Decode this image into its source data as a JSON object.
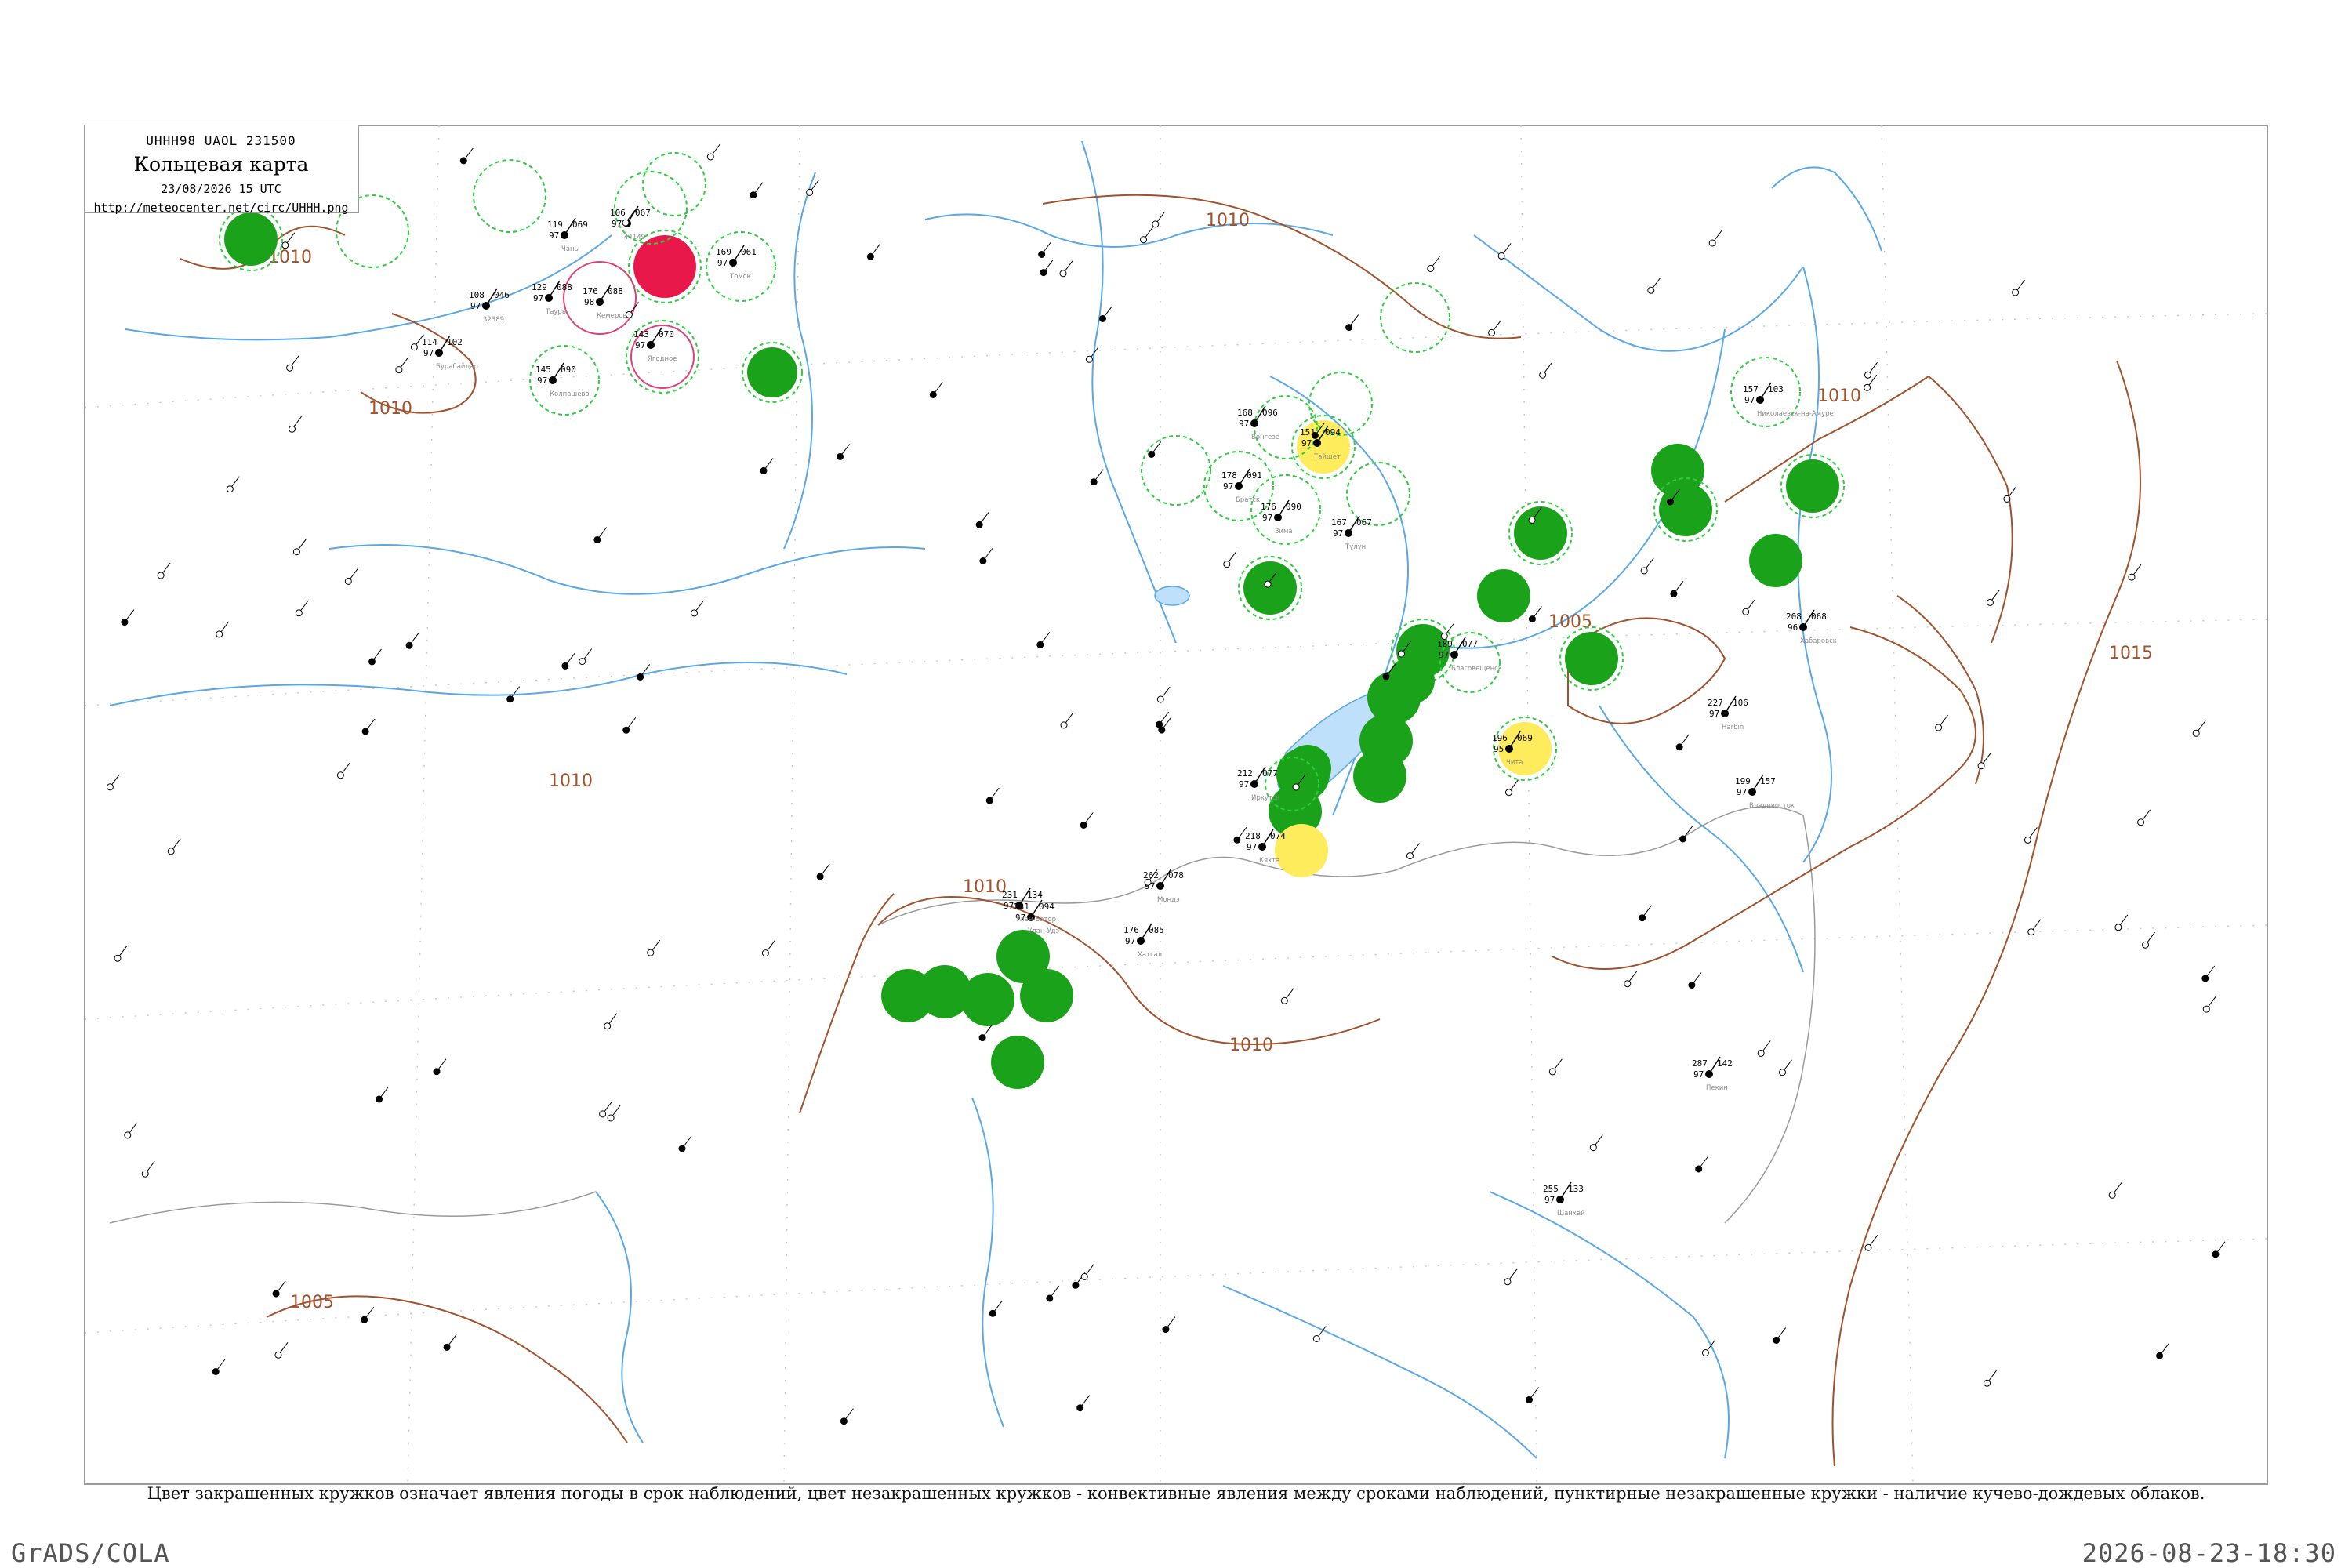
{
  "header": {
    "code": "UHHH98  UAOL  231500",
    "title": "Кольцевая карта",
    "date": "23/08/2026 15 UTC",
    "url": "http://meteocenter.net/circ/UHHH.png"
  },
  "caption": "Цвет закрашенных кружков означает явления погоды в срок наблюдений, цвет незакрашенных кружков - конвективные явления между сроками наблюдений, пунктирные незакрашенные кружки - наличие кучево-дождевых облаков.",
  "footer": {
    "left": "GrADS/COLA",
    "right": "2026-08-23-18:30"
  },
  "isobar_labels": [
    {
      "text": "1010"
    },
    {
      "text": "1010"
    },
    {
      "text": "1010"
    },
    {
      "text": "1010"
    },
    {
      "text": "1010"
    },
    {
      "text": "1010"
    },
    {
      "text": "1010"
    },
    {
      "text": "1005"
    },
    {
      "text": "1005"
    },
    {
      "text": "1015"
    }
  ],
  "colors": {
    "heavy_rain": "#1aa31a",
    "rain_ring": "#2ecc40",
    "fog_yellow": "#ffec5c",
    "thunder_red": "#e8184a",
    "thunder_ring": "#e0407a",
    "isobar": "#a0522d",
    "river": "#5aa7e6",
    "border": "#8a8a8a"
  },
  "stations": [
    {
      "name": "32389",
      "t": "108",
      "tw": "97",
      "p": "046"
    },
    {
      "name": "Бурабайдар",
      "t": "114",
      "tw": "97",
      "p": "102"
    },
    {
      "name": "Тауры",
      "t": "129",
      "tw": "97",
      "p": "088"
    },
    {
      "name": "Чаны",
      "t": "119",
      "tw": "97",
      "p": "069"
    },
    {
      "name": "44149",
      "t": "106",
      "tw": "97",
      "p": "067"
    },
    {
      "name": "Томск",
      "t": "169",
      "tw": "97",
      "p": "061"
    },
    {
      "name": "Колпашево",
      "t": "145",
      "tw": "97",
      "p": "090"
    },
    {
      "name": "Ягодное",
      "t": "143",
      "tw": "97",
      "p": "070"
    },
    {
      "name": "Кемерово",
      "t": "176",
      "tw": "98",
      "p": "088"
    },
    {
      "name": "Вонгезе",
      "t": "168",
      "tw": "97",
      "p": "096"
    },
    {
      "name": "Тайшет",
      "t": "151",
      "tw": "97",
      "p": "094"
    },
    {
      "name": "Братск",
      "t": "178",
      "tw": "97",
      "p": "091"
    },
    {
      "name": "Зима",
      "t": "176",
      "tw": "97",
      "p": "090"
    },
    {
      "name": "Тулун",
      "t": "167",
      "tw": "97",
      "p": "067"
    },
    {
      "name": "Иркутск",
      "t": "212",
      "tw": "97",
      "p": "077"
    },
    {
      "name": "Улан-Удэ",
      "t": "231",
      "tw": "97",
      "p": "094"
    },
    {
      "name": "Кяхта",
      "t": "218",
      "tw": "97",
      "p": "074"
    },
    {
      "name": "Чита",
      "t": "196",
      "tw": "95",
      "p": "069"
    },
    {
      "name": "Благовещенск",
      "t": "189",
      "tw": "97",
      "p": "077"
    },
    {
      "name": "Хабаровск",
      "t": "208",
      "tw": "96",
      "p": "068"
    },
    {
      "name": "Николаевск-на-Амуре",
      "t": "157",
      "tw": "97",
      "p": "103"
    },
    {
      "name": "Улан-Батор",
      "t": "231",
      "tw": "97",
      "p": "134"
    },
    {
      "name": "Мондэ",
      "t": "262",
      "tw": "97",
      "p": "078"
    },
    {
      "name": "Хатгал",
      "t": "176",
      "tw": "97",
      "p": "085"
    },
    {
      "name": "Harbin",
      "t": "227",
      "tw": "97",
      "p": "106"
    },
    {
      "name": "Владивосток",
      "t": "199",
      "tw": "97",
      "p": "157"
    },
    {
      "name": "Пекин",
      "t": "287",
      "tw": "97",
      "p": "142"
    },
    {
      "name": "Шанхай",
      "t": "255",
      "tw": "97",
      "p": "133"
    }
  ]
}
